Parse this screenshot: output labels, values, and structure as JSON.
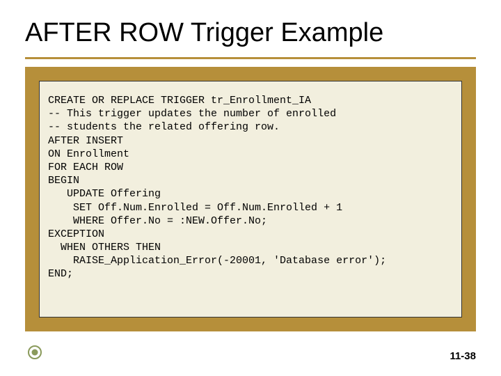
{
  "title": "AFTER ROW Trigger Example",
  "code": "CREATE OR REPLACE TRIGGER tr_Enrollment_IA\n-- This trigger updates the number of enrolled\n-- students the related offering row.\nAFTER INSERT\nON Enrollment\nFOR EACH ROW\nBEGIN\n   UPDATE Offering\n    SET Off.Num.Enrolled = Off.Num.Enrolled + 1\n    WHERE Offer.No = :NEW.Offer.No;\nEXCEPTION\n  WHEN OTHERS THEN\n    RAISE_Application_Error(-20001, 'Database error');\nEND;",
  "footer": "11-38",
  "colors": {
    "accent": "#b68f3a",
    "panel": "#f2efde"
  }
}
